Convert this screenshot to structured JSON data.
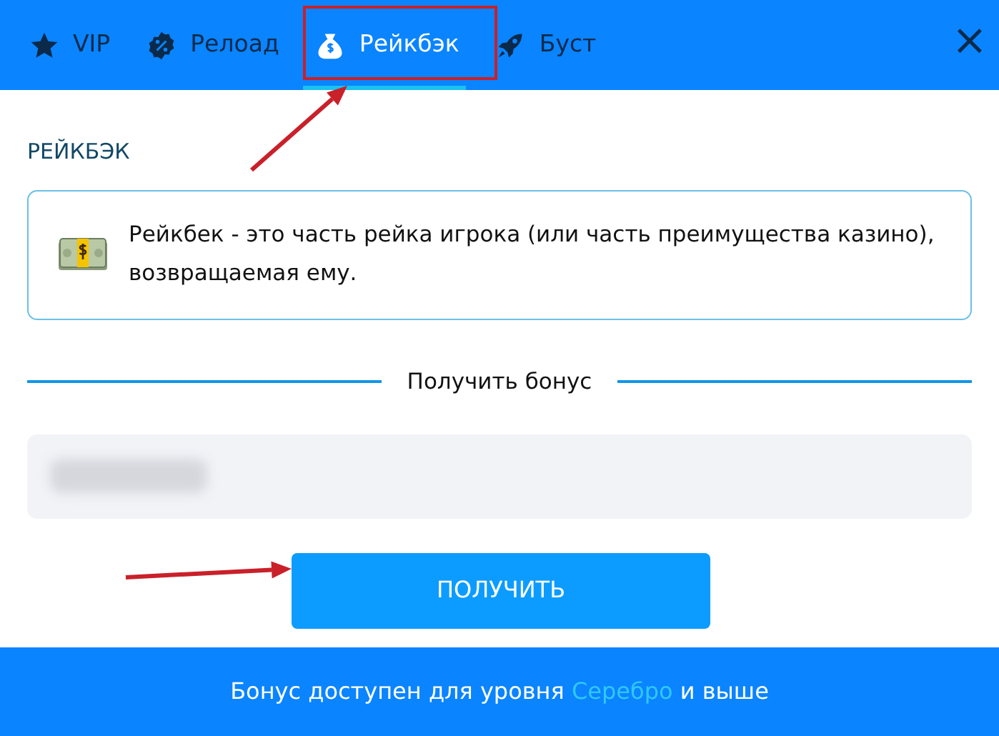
{
  "tabs": [
    {
      "label": "VIP",
      "selected": false
    },
    {
      "label": "Релоад",
      "selected": false
    },
    {
      "label": "Рейкбэк",
      "selected": true
    },
    {
      "label": "Буст",
      "selected": false
    }
  ],
  "close": {
    "symbol": "×"
  },
  "section_title": "РЕЙКБЭК",
  "info": {
    "text": "Рейкбек - это часть рейка игрока (или часть преимущества казино), возвращаемая ему."
  },
  "divider_label": "Получить бонус",
  "field": {
    "redacted": true
  },
  "button": {
    "label": "ПОЛУЧИТЬ"
  },
  "footer": {
    "prefix": "Бонус доступен для уровня",
    "tier": "Серебро",
    "suffix": "и выше"
  },
  "annotations": [
    {
      "kind": "box"
    },
    {
      "kind": "arrow"
    },
    {
      "kind": "arrow"
    }
  ]
}
